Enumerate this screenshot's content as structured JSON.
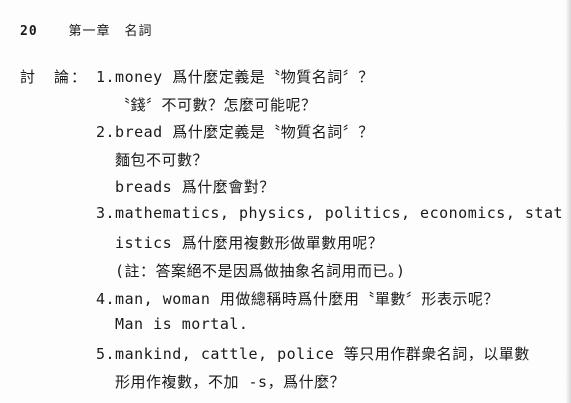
{
  "header": {
    "page_number": "20",
    "chapter_title": "第一章　名詞"
  },
  "section_label": "討　論：",
  "items": [
    {
      "text": "1.money 爲什麼定義是〝物質名詞〞？"
    },
    {
      "text": "〝錢〞不可數？怎麼可能呢？"
    },
    {
      "text": "2.bread 爲什麼定義是〝物質名詞〞？"
    },
    {
      "text": "麵包不可數？"
    },
    {
      "text": "breads 爲什麼會對？"
    },
    {
      "text": "3.mathematics, physics, politics, economics, stat-"
    },
    {
      "text": "istics 爲什麼用複數形做單數用呢？"
    },
    {
      "text": "(註：答案絕不是因爲做抽象名詞用而已。)"
    },
    {
      "text": "4.man, woman 用做總稱時爲什麼用〝單數〞形表示呢？"
    },
    {
      "text": "Man is mortal."
    },
    {
      "text": "5.mankind, cattle, police 等只用作群衆名詞，以單數"
    },
    {
      "text": "形用作複數，不加 -s，爲什麼？"
    }
  ]
}
